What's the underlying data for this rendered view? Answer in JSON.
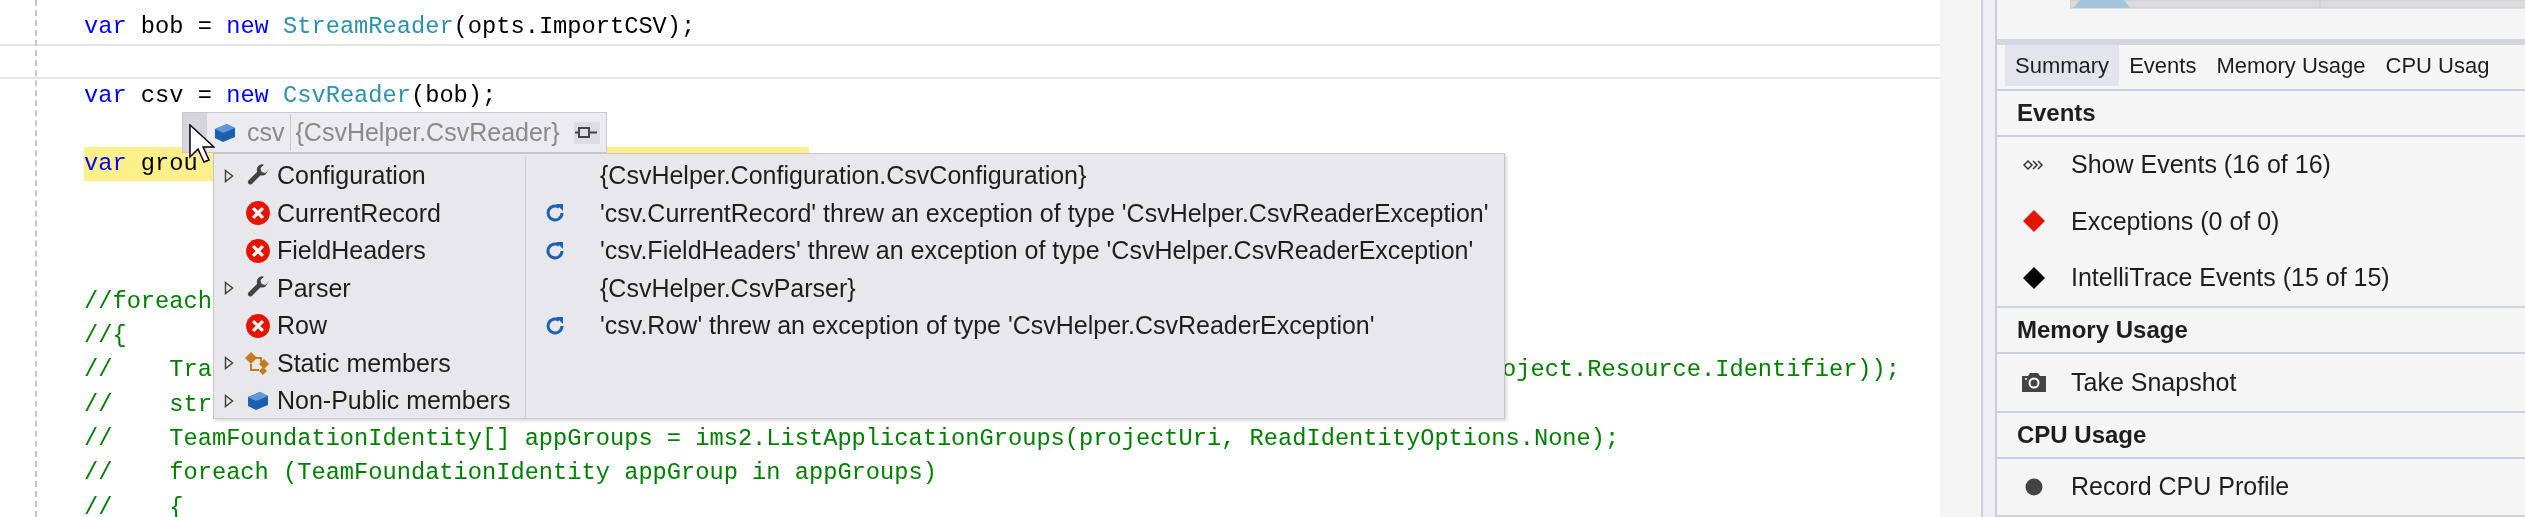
{
  "editor": {
    "lines": [
      {
        "current": false,
        "highlighted": false,
        "segments": [
          {
            "kind": "keyword",
            "text": "var"
          },
          {
            "kind": "plain",
            "text": " bob = "
          },
          {
            "kind": "keyword",
            "text": "new "
          },
          {
            "kind": "type",
            "text": "StreamReader"
          },
          {
            "kind": "plain",
            "text": "(opts.ImportCSV);"
          }
        ]
      },
      {
        "current": true,
        "highlighted": false
      },
      {
        "current": false,
        "highlighted": false,
        "segments": [
          {
            "kind": "keyword",
            "text": "var"
          },
          {
            "kind": "plain",
            "text": " csv = "
          },
          {
            "kind": "keyword",
            "text": "new "
          },
          {
            "kind": "type",
            "text": "CsvReader"
          },
          {
            "kind": "plain",
            "text": "(bob);"
          }
        ]
      },
      {
        "current": false,
        "highlighted": false
      },
      {
        "current": false,
        "highlighted": true,
        "segments": [
          {
            "kind": "keyword",
            "text": "var"
          },
          {
            "kind": "plain",
            "text": " grou"
          }
        ]
      },
      {
        "current": false,
        "highlighted": false
      },
      {
        "current": false,
        "highlighted": false
      },
      {
        "current": false,
        "highlighted": false
      },
      {
        "current": false,
        "highlighted": false,
        "segments": [
          {
            "kind": "comment",
            "text": "//foreach"
          }
        ]
      },
      {
        "current": false,
        "highlighted": false,
        "segments": [
          {
            "kind": "comment",
            "text": "//{"
          }
        ]
      },
      {
        "current": false,
        "highlighted": false,
        "segments": [
          {
            "kind": "comment",
            "text": "//    Tra"
          }
        ],
        "right_segments": [
          {
            "kind": "comment",
            "text": "oject.Resource.Identifier));"
          }
        ]
      },
      {
        "current": false,
        "highlighted": false,
        "segments": [
          {
            "kind": "comment",
            "text": "//    str"
          }
        ]
      },
      {
        "current": false,
        "highlighted": false,
        "segments": [
          {
            "kind": "comment",
            "text": "//    TeamFoundationIdentity[] appGroups = ims2.ListApplicationGroups(projectUri, ReadIdentityOptions.None);"
          }
        ]
      },
      {
        "current": false,
        "highlighted": false,
        "segments": [
          {
            "kind": "comment",
            "text": "//    foreach (TeamFoundationIdentity appGroup in appGroups)"
          }
        ]
      },
      {
        "current": false,
        "highlighted": false,
        "segments": [
          {
            "kind": "comment",
            "text": "//    {"
          }
        ]
      }
    ]
  },
  "datatip": {
    "expanded": true,
    "expression": "csv",
    "value": "{CsvHelper.CsvReader}",
    "members": [
      {
        "kind": "property",
        "name": "Configuration",
        "expandable": true,
        "refreshable": false,
        "value": "{CsvHelper.Configuration.CsvConfiguration}"
      },
      {
        "kind": "error",
        "name": "CurrentRecord",
        "expandable": false,
        "refreshable": true,
        "value": "'csv.CurrentRecord' threw an exception of type 'CsvHelper.CsvReaderException'"
      },
      {
        "kind": "error",
        "name": "FieldHeaders",
        "expandable": false,
        "refreshable": true,
        "value": "'csv.FieldHeaders' threw an exception of type 'CsvHelper.CsvReaderException'"
      },
      {
        "kind": "property",
        "name": "Parser",
        "expandable": true,
        "refreshable": false,
        "value": "{CsvHelper.CsvParser}"
      },
      {
        "kind": "error",
        "name": "Row",
        "expandable": false,
        "refreshable": true,
        "value": "'csv.Row' threw an exception of type 'CsvHelper.CsvReaderException'"
      },
      {
        "kind": "static",
        "name": "Static members",
        "expandable": true,
        "refreshable": false
      },
      {
        "kind": "object",
        "name": "Non-Public members",
        "expandable": true,
        "refreshable": false
      }
    ]
  },
  "diagnostics": {
    "tabs": [
      {
        "label": "Summary",
        "selected": true
      },
      {
        "label": "Events",
        "selected": false
      },
      {
        "label": "Memory Usage",
        "selected": false
      },
      {
        "label": "CPU Usag",
        "selected": false
      }
    ],
    "sections": [
      {
        "title": "Events",
        "items": [
          {
            "kind": "events",
            "label": "Show Events (16 of 16)"
          },
          {
            "kind": "exception",
            "label": "Exceptions (0 of 0)"
          },
          {
            "kind": "intellitrace",
            "label": "IntelliTrace Events (15 of 15)"
          }
        ]
      },
      {
        "title": "Memory Usage",
        "items": [
          {
            "kind": "snapshot",
            "label": "Take Snapshot"
          }
        ]
      },
      {
        "title": "CPU Usage",
        "items": [
          {
            "kind": "record",
            "label": "Record CPU Profile"
          }
        ]
      }
    ]
  }
}
